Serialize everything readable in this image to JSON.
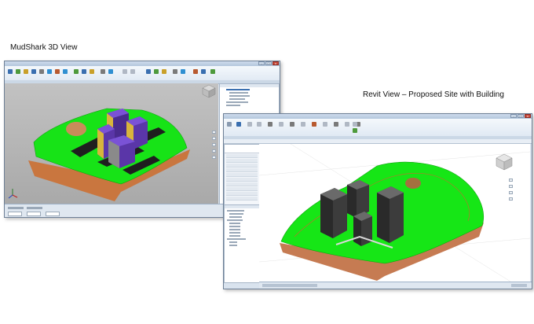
{
  "captions": {
    "mudshark": "MudShark 3D View",
    "revit": "Revit View – Proposed Site with Building"
  },
  "mudshark_window": {
    "ribbon_tabs": [
      "",
      "",
      "",
      ""
    ],
    "icons": [
      "view-cube-icon",
      "axis-triad-icon",
      "navigation-bar-icon"
    ]
  },
  "revit_window": {
    "icons": [
      "view-cube-icon",
      "navigation-bar-icon",
      "properties-palette-icon",
      "project-browser-icon"
    ]
  },
  "colors": {
    "grass": "#19e619",
    "soil": "#cf7a4b",
    "road": "#1f1f1f",
    "building_purple": "#6b3fc4",
    "building_dark": "#3a3a3a",
    "mud_viewport_bg": "#b5b5b5",
    "revit_viewport_bg": "#ffffff"
  }
}
